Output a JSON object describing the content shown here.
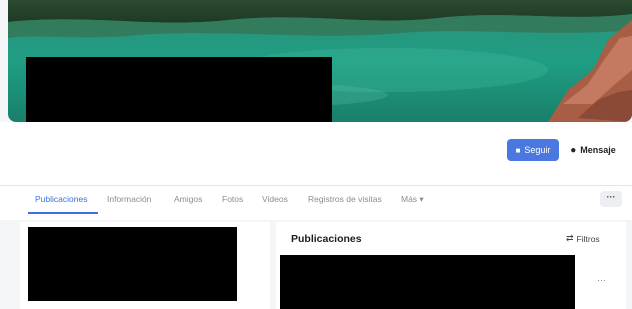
{
  "profile": {
    "follow_label": "Seguir",
    "message_label": "Mensaje"
  },
  "tabs": [
    {
      "label": "Publicaciones",
      "active": true
    },
    {
      "label": "Información",
      "active": false
    },
    {
      "label": "Amigos",
      "active": false
    },
    {
      "label": "Fotos",
      "active": false
    },
    {
      "label": "Videos",
      "active": false
    },
    {
      "label": "Registros de visitas",
      "active": false
    },
    {
      "label": "Más ▾",
      "active": false
    }
  ],
  "nav_more": "···",
  "posts": {
    "title": "Publicaciones",
    "filters_label": "Filtros",
    "post_menu": "···"
  },
  "colors": {
    "accent": "#3b6fe0",
    "follow_button": "#4a78e0"
  }
}
